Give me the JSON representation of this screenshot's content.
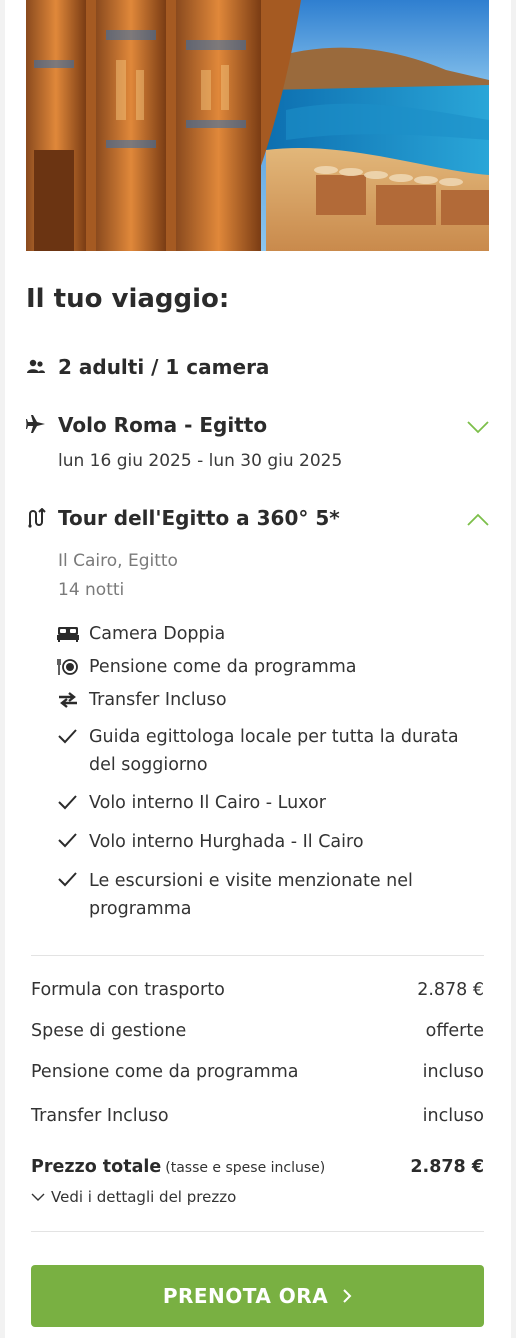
{
  "hero": {
    "image": "egypt-temple-and-beach-photo"
  },
  "trip": {
    "title": "Il tuo viaggio:",
    "guests": {
      "icon": "people-icon",
      "label": "2 adulti / 1 camera"
    },
    "flight": {
      "icon": "airplane-icon",
      "title": "Volo Roma - Egitto",
      "dates": "lun 16 giu 2025 - lun 30 giu 2025",
      "toggle_icon": "chevron-down-icon"
    },
    "tour": {
      "icon": "tour-route-icon",
      "title": "Tour dell'Egitto a 360° 5*",
      "location": "Il Cairo, Egitto",
      "nights": "14 notti",
      "toggle_icon": "chevron-up-icon",
      "features": [
        {
          "icon": "bed-icon",
          "text": "Camera Doppia"
        },
        {
          "icon": "meal-icon",
          "text": "Pensione come da programma"
        },
        {
          "icon": "transfer-icon",
          "text": "Transfer Incluso"
        },
        {
          "icon": "check-icon",
          "text": "Guida egittologa locale per tutta la durata del soggiorno"
        },
        {
          "icon": "check-icon",
          "text": "Volo interno Il Cairo - Luxor"
        },
        {
          "icon": "check-icon",
          "text": "Volo interno Hurghada - Il Cairo"
        },
        {
          "icon": "check-icon",
          "text": "Le escursioni e visite menzionate nel programma"
        }
      ]
    }
  },
  "pricing": {
    "rows": [
      {
        "label": "Formula con trasporto",
        "value": "2.878 €"
      },
      {
        "label": "Spese di gestione",
        "value": "offerte"
      },
      {
        "label": "Pensione come da programma",
        "value": "incluso"
      },
      {
        "label": "Transfer Incluso",
        "value": "incluso"
      }
    ],
    "total_label": "Prezzo totale",
    "total_note": "(tasse e spese incluse)",
    "total_value": "2.878 €",
    "details_link": "Vedi i dettagli del prezzo"
  },
  "cta": {
    "label": "PRENOTA ORA"
  },
  "colors": {
    "accent": "#79b042",
    "chevron": "#7cbf4a",
    "text": "#2b2b2b"
  }
}
